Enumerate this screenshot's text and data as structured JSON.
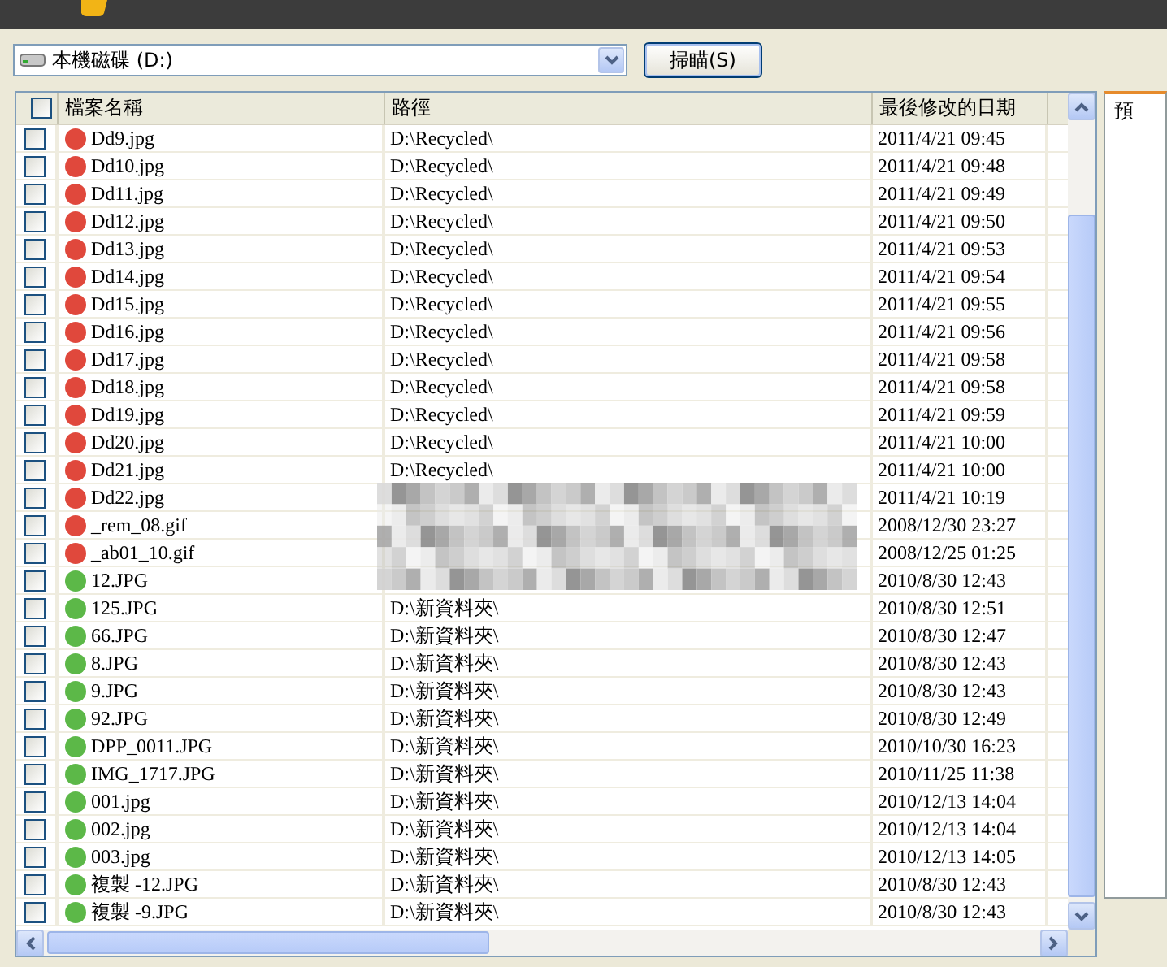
{
  "drive_select": {
    "value": "本機磁碟 (D:)"
  },
  "scan_button": {
    "label": "掃瞄(S)"
  },
  "table": {
    "header_checked": false,
    "columns": [
      "檔案名稱",
      "路徑",
      "最後修改的日期"
    ],
    "rows": [
      {
        "checked": false,
        "color": "#e0483c",
        "name": "Dd9.jpg",
        "path": "D:\\Recycled\\",
        "date": "2011/4/21 09:45"
      },
      {
        "checked": false,
        "color": "#e0483c",
        "name": "Dd10.jpg",
        "path": "D:\\Recycled\\",
        "date": "2011/4/21 09:48"
      },
      {
        "checked": false,
        "color": "#e0483c",
        "name": "Dd11.jpg",
        "path": "D:\\Recycled\\",
        "date": "2011/4/21 09:49"
      },
      {
        "checked": false,
        "color": "#e0483c",
        "name": "Dd12.jpg",
        "path": "D:\\Recycled\\",
        "date": "2011/4/21 09:50"
      },
      {
        "checked": false,
        "color": "#e0483c",
        "name": "Dd13.jpg",
        "path": "D:\\Recycled\\",
        "date": "2011/4/21 09:53"
      },
      {
        "checked": false,
        "color": "#e0483c",
        "name": "Dd14.jpg",
        "path": "D:\\Recycled\\",
        "date": "2011/4/21 09:54"
      },
      {
        "checked": false,
        "color": "#e0483c",
        "name": "Dd15.jpg",
        "path": "D:\\Recycled\\",
        "date": "2011/4/21 09:55"
      },
      {
        "checked": false,
        "color": "#e0483c",
        "name": "Dd16.jpg",
        "path": "D:\\Recycled\\",
        "date": "2011/4/21 09:56"
      },
      {
        "checked": false,
        "color": "#e0483c",
        "name": "Dd17.jpg",
        "path": "D:\\Recycled\\",
        "date": "2011/4/21 09:58"
      },
      {
        "checked": false,
        "color": "#e0483c",
        "name": "Dd18.jpg",
        "path": "D:\\Recycled\\",
        "date": "2011/4/21 09:58"
      },
      {
        "checked": false,
        "color": "#e0483c",
        "name": "Dd19.jpg",
        "path": "D:\\Recycled\\",
        "date": "2011/4/21 09:59"
      },
      {
        "checked": false,
        "color": "#e0483c",
        "name": "Dd20.jpg",
        "path": "D:\\Recycled\\",
        "date": "2011/4/21 10:00"
      },
      {
        "checked": false,
        "color": "#e0483c",
        "name": "Dd21.jpg",
        "path": "D:\\Recycled\\",
        "date": "2011/4/21 10:00"
      },
      {
        "checked": false,
        "color": "#e0483c",
        "name": "Dd22.jpg",
        "date": "2011/4/21 10:19"
      },
      {
        "checked": false,
        "color": "#e0483c",
        "name": "_rem_08.gif",
        "date": "2008/12/30 23:27"
      },
      {
        "checked": false,
        "color": "#e0483c",
        "name": "_ab01_10.gif",
        "date": "2008/12/25 01:25"
      },
      {
        "checked": false,
        "color": "#5cb848",
        "name": "12.JPG",
        "date": "2010/8/30 12:43"
      },
      {
        "checked": false,
        "color": "#5cb848",
        "name": "125.JPG",
        "path": "D:\\新資料夾\\",
        "date": "2010/8/30 12:51"
      },
      {
        "checked": false,
        "color": "#5cb848",
        "name": "66.JPG",
        "path": "D:\\新資料夾\\",
        "date": "2010/8/30 12:47"
      },
      {
        "checked": false,
        "color": "#5cb848",
        "name": "8.JPG",
        "path": "D:\\新資料夾\\",
        "date": "2010/8/30 12:43"
      },
      {
        "checked": false,
        "color": "#5cb848",
        "name": "9.JPG",
        "path": "D:\\新資料夾\\",
        "date": "2010/8/30 12:43"
      },
      {
        "checked": false,
        "color": "#5cb848",
        "name": "92.JPG",
        "path": "D:\\新資料夾\\",
        "date": "2010/8/30 12:49"
      },
      {
        "checked": false,
        "color": "#5cb848",
        "name": "DPP_0011.JPG",
        "path": "D:\\新資料夾\\",
        "date": "2010/10/30 16:23"
      },
      {
        "checked": false,
        "color": "#5cb848",
        "name": "IMG_1717.JPG",
        "path": "D:\\新資料夾\\",
        "date": "2010/11/25 11:38"
      },
      {
        "checked": false,
        "color": "#5cb848",
        "name": "001.jpg",
        "path": "D:\\新資料夾\\",
        "date": "2010/12/13 14:04"
      },
      {
        "checked": false,
        "color": "#5cb848",
        "name": "002.jpg",
        "path": "D:\\新資料夾\\",
        "date": "2010/12/13 14:04"
      },
      {
        "checked": false,
        "color": "#5cb848",
        "name": "003.jpg",
        "path": "D:\\新資料夾\\",
        "date": "2010/12/13 14:05"
      },
      {
        "checked": false,
        "color": "#5cb848",
        "name": "複製 -12.JPG",
        "path": "D:\\新資料夾\\",
        "date": "2010/8/30 12:43"
      },
      {
        "checked": false,
        "color": "#5cb848",
        "name": "複製 -9.JPG",
        "path": "D:\\新資料夾\\",
        "date": "2010/8/30 12:43"
      }
    ]
  },
  "preview": {
    "title": "預"
  }
}
